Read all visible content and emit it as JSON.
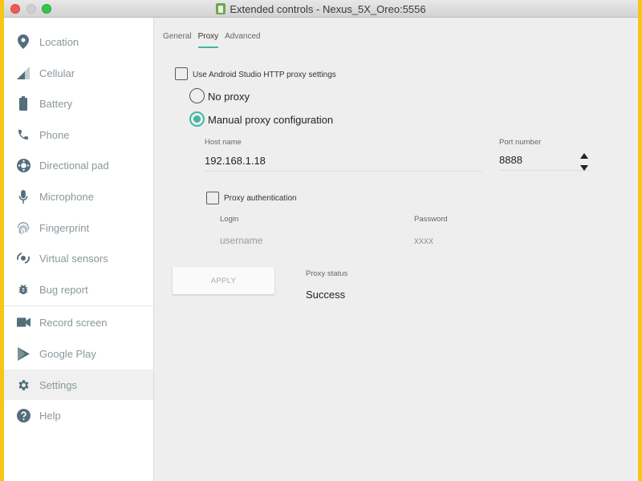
{
  "window": {
    "title": "Extended controls - Nexus_5X_Oreo:5556"
  },
  "sidebar": {
    "items": [
      {
        "label": "Location",
        "icon": "location-pin-icon"
      },
      {
        "label": "Cellular",
        "icon": "signal-icon"
      },
      {
        "label": "Battery",
        "icon": "battery-icon"
      },
      {
        "label": "Phone",
        "icon": "phone-icon"
      },
      {
        "label": "Directional pad",
        "icon": "dpad-icon"
      },
      {
        "label": "Microphone",
        "icon": "microphone-icon"
      },
      {
        "label": "Fingerprint",
        "icon": "fingerprint-icon"
      },
      {
        "label": "Virtual sensors",
        "icon": "rotate-sensor-icon"
      },
      {
        "label": "Bug report",
        "icon": "bug-icon"
      },
      {
        "label": "Record screen",
        "icon": "video-camera-icon"
      },
      {
        "label": "Google Play",
        "icon": "play-store-icon"
      },
      {
        "label": "Settings",
        "icon": "gear-icon",
        "active": true
      },
      {
        "label": "Help",
        "icon": "help-icon"
      }
    ]
  },
  "tabs": [
    {
      "label": "General"
    },
    {
      "label": "Proxy",
      "active": true
    },
    {
      "label": "Advanced"
    }
  ],
  "proxy": {
    "use_studio_label": "Use Android Studio HTTP proxy settings",
    "use_studio_checked": false,
    "no_proxy_label": "No proxy",
    "manual_label": "Manual proxy configuration",
    "selected": "manual",
    "host_label": "Host name",
    "host_value": "192.168.1.18",
    "port_label": "Port number",
    "port_value": "8888",
    "auth_label": "Proxy authentication",
    "auth_checked": false,
    "login_label": "Login",
    "login_placeholder": "username",
    "password_label": "Password",
    "password_placeholder": "xxxx",
    "apply_label": "APPLY",
    "status_label": "Proxy status",
    "status_value": "Success"
  },
  "colors": {
    "accent": "#3fb7a4",
    "icon": "#546e7a",
    "nav_text": "#8a979d"
  }
}
